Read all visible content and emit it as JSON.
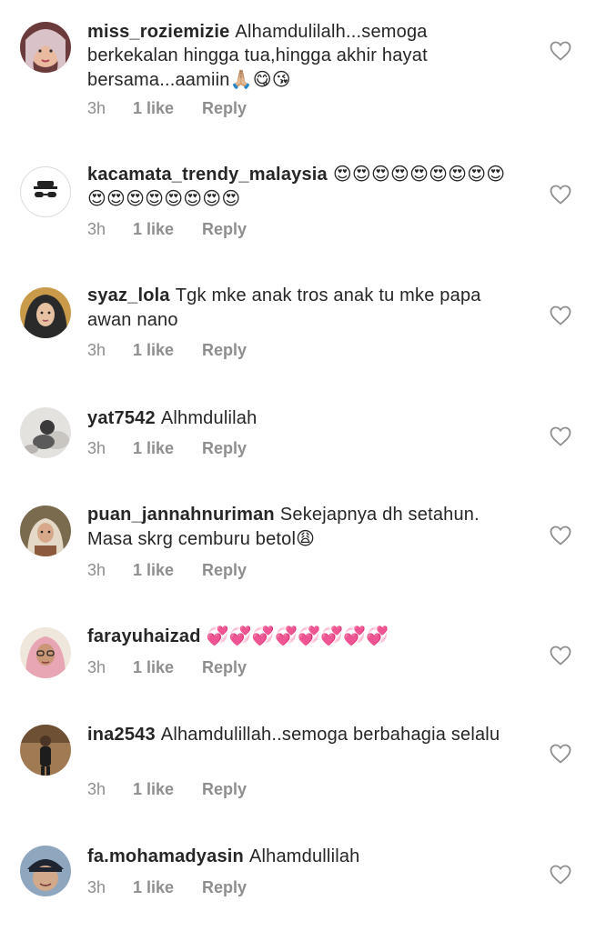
{
  "comments": [
    {
      "username": "miss_roziemizie",
      "text": "Alhamdulilalh...semoga berkekalan hingga tua,hingga akhir hayat bersama...aamiin",
      "emojis": "🙏🏼😋😘",
      "time": "3h",
      "likes": "1 like",
      "reply": "Reply"
    },
    {
      "username": "kacamata_trendy_malaysia",
      "text": "",
      "emojis": "😍😍😍😍😍😍😍😍😍😍😍😍😍😍😍😍😍",
      "time": "3h",
      "likes": "1 like",
      "reply": "Reply"
    },
    {
      "username": "syaz_lola",
      "text": "Tgk mke anak tros anak tu mke papa awan nano",
      "emojis": "",
      "time": "3h",
      "likes": "1 like",
      "reply": "Reply"
    },
    {
      "username": "yat7542",
      "text": "Alhmdulilah",
      "emojis": "",
      "time": "3h",
      "likes": "1 like",
      "reply": "Reply"
    },
    {
      "username": "puan_jannahnuriman",
      "text": "Sekejapnya dh setahun. Masa skrg cemburu betol",
      "emojis": "😩",
      "time": "3h",
      "likes": "1 like",
      "reply": "Reply"
    },
    {
      "username": "farayuhaizad",
      "text": "",
      "emojis": "💞💞💞💞💞💞💞💞",
      "time": "3h",
      "likes": "1 like",
      "reply": "Reply"
    },
    {
      "username": "ina2543",
      "text": "Alhamdulillah..semoga berbahagia selalu",
      "emojis": "",
      "time": "3h",
      "likes": "1 like",
      "reply": "Reply"
    },
    {
      "username": "fa.mohamadyasin",
      "text": "Alhamdullilah",
      "emojis": "",
      "time": "3h",
      "likes": "1 like",
      "reply": "Reply"
    }
  ],
  "icons": {
    "like": "heart-outline-icon"
  },
  "colors": {
    "text": "#262626",
    "meta": "#8e8e8e",
    "heart": "#8e8e8e"
  }
}
